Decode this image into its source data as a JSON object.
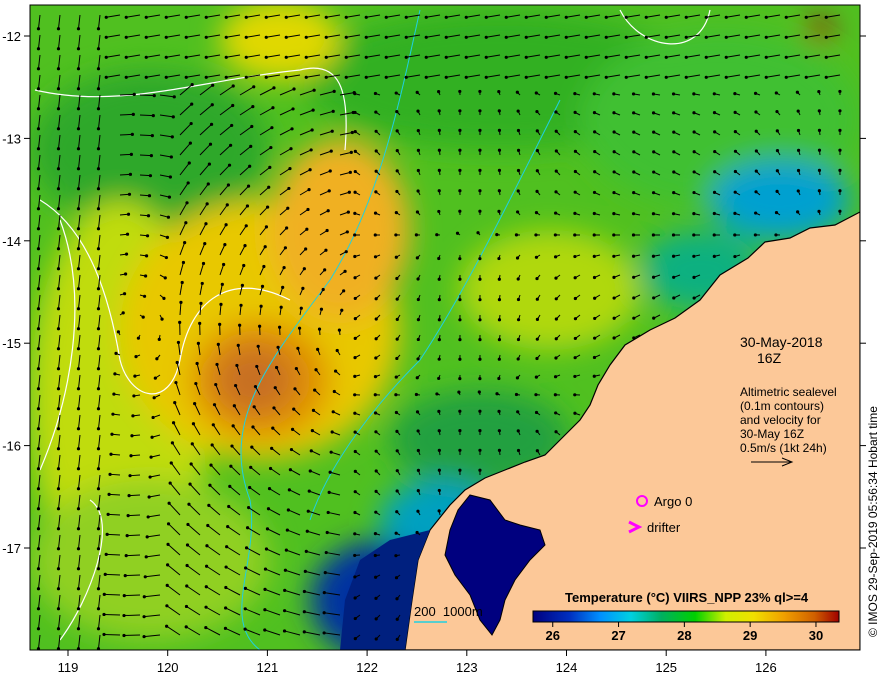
{
  "map": {
    "x_ticks": [
      "119",
      "120",
      "121",
      "122",
      "123",
      "124",
      "125",
      "126"
    ],
    "y_ticks": [
      "-12",
      "-13",
      "-14",
      "-15",
      "-16",
      "-17"
    ],
    "date": "30-May-2018",
    "time": "16Z",
    "note_lines": [
      "Altimetric sealevel",
      "(0.1m contours)",
      "and velocity for",
      "30-May 16Z",
      "0.5m/s (1kt 24h)"
    ],
    "legend_argo": "Argo 0",
    "legend_drifter": "drifter",
    "depth_label": "200  1000m",
    "copyright": "© IMOS 29-Sep-2019 05:56:34 Hobart time"
  },
  "colorbar": {
    "title": "Temperature (°C) VIIRS_NPP 23% ql>=4",
    "ticks": [
      "26",
      "27",
      "28",
      "29",
      "30"
    ],
    "range": [
      25.7,
      30.35
    ],
    "colors": [
      "#00007f",
      "#0030c0",
      "#0090ff",
      "#00d0e0",
      "#00b060",
      "#00d000",
      "#d0f000",
      "#f0e000",
      "#f0a000",
      "#d06000",
      "#a00000"
    ]
  },
  "colors": {
    "land": "#fcc898",
    "argo": "#ff00ff",
    "drifter": "#ff00ff",
    "contour": "#ffffff",
    "isobath": "#20d0e0"
  }
}
